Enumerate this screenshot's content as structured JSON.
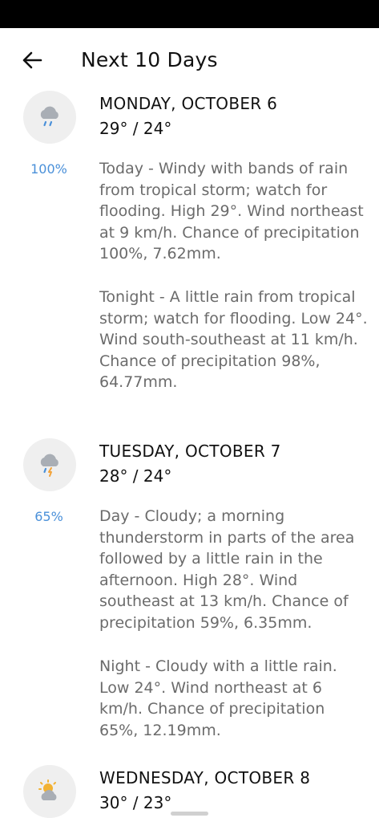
{
  "header": {
    "title": "Next 10 Days"
  },
  "days": [
    {
      "name": "MONDAY, OCTOBER 6",
      "temps": "29° / 24°",
      "icon": "rain-cloud-icon",
      "precip": "100%",
      "day_text": "Today - Windy with bands of rain from tropical storm; watch for flooding. High 29°. Wind northeast at 9 km/h. Chance of precipitation 100%, 7.62mm.",
      "night_text": "Tonight - A little rain from tropical storm; watch for flooding. Low 24°. Wind south-southeast at 11 km/h. Chance of precipitation 98%, 64.77mm."
    },
    {
      "name": "TUESDAY, OCTOBER 7",
      "temps": "28° / 24°",
      "icon": "thunderstorm-cloud-icon",
      "precip": "65%",
      "day_text": "Day - Cloudy; a morning thunderstorm in parts of the area followed by a little rain in the afternoon. High 28°. Wind southeast at 13 km/h. Chance of precipitation 59%, 6.35mm.",
      "night_text": "Night - Cloudy with a little rain. Low 24°. Wind northeast at 6 km/h. Chance of precipitation 65%, 12.19mm."
    },
    {
      "name": "WEDNESDAY, OCTOBER 8",
      "temps": "30° / 23°",
      "icon": "partly-cloudy-icon"
    }
  ]
}
